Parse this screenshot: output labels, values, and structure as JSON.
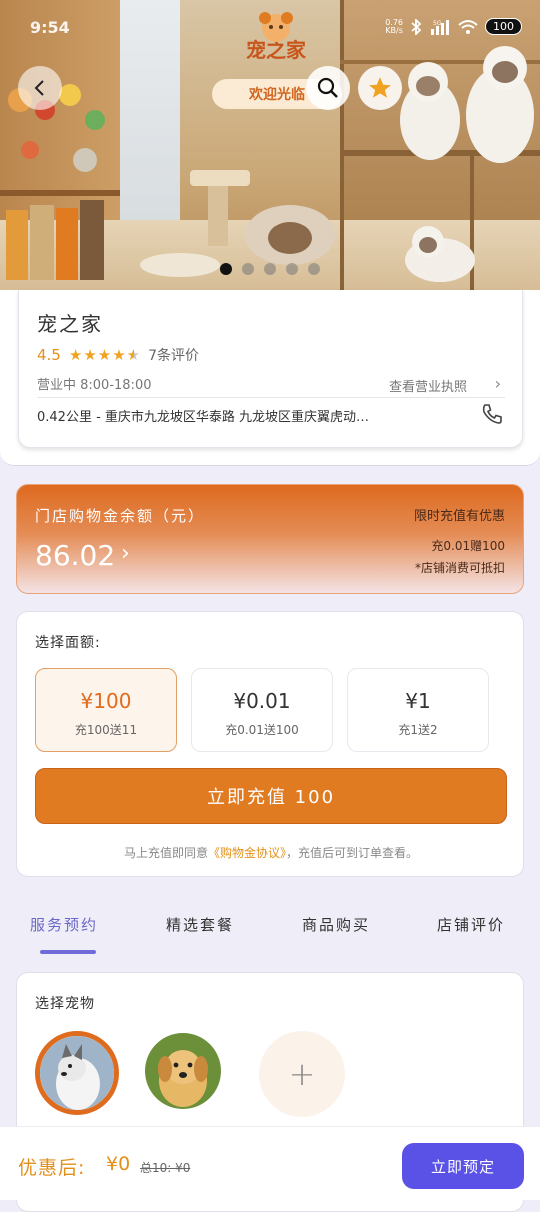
{
  "status_bar": {
    "time": "9:54",
    "net_speed_value": "0.76",
    "net_speed_unit": "KB/s",
    "network": "5G",
    "battery": "100"
  },
  "hero": {
    "brand_name": "宠之家",
    "welcome": "欢迎光临",
    "slides": 5,
    "active_slide": 1
  },
  "store": {
    "name": "宠之家",
    "rating": "4.5",
    "stars": 4.5,
    "review_count": "7条评价",
    "hours": "营业中 8:00-18:00",
    "license_link": "查看营业执照",
    "address": "0.42公里 - 重庆市九龙坡区华泰路 九龙坡区重庆翼虎动…"
  },
  "balance": {
    "title": "门店购物金余额（元）",
    "amount": "86.02",
    "promo": "限时充值有优惠",
    "offer": "充0.01赠100",
    "note": "*店铺消费可抵扣"
  },
  "topup": {
    "label": "选择面额:",
    "options": [
      {
        "price": "¥100",
        "bonus": "充100送11"
      },
      {
        "price": "¥0.01",
        "bonus": "充0.01送100"
      },
      {
        "price": "¥1",
        "bonus": "充1送2"
      }
    ],
    "selected_index": 0,
    "button": "立即充值 100",
    "agree_prefix": "马上充值即同意",
    "agree_link": "《购物金协议》",
    "agree_suffix": "，充值后可到订单查看。"
  },
  "tabs": [
    "服务预约",
    "精选套餐",
    "商品购买",
    "店铺评价"
  ],
  "active_tab": 0,
  "pets": {
    "title": "选择宠物",
    "selected_index": 0
  },
  "bottom": {
    "discount_label": "优惠后:",
    "discount_price": "¥0",
    "original_price": "总10: ¥0",
    "book_button": "立即预定"
  },
  "colors": {
    "accent_orange": "#e07b22",
    "accent_purple": "#5a52e6",
    "star": "#f0a323"
  }
}
